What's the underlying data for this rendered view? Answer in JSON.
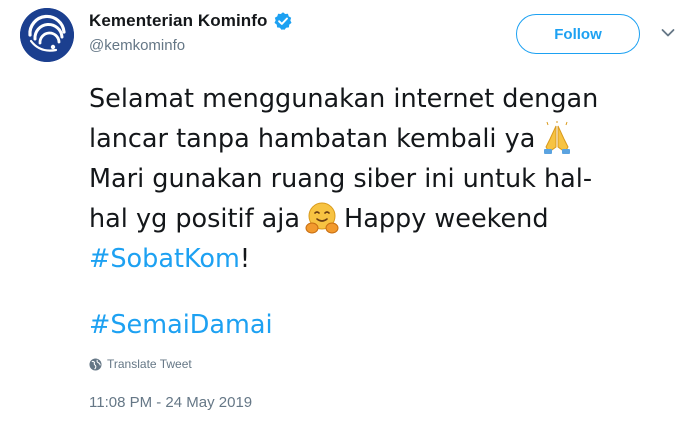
{
  "author": {
    "display_name": "Kementerian Kominfo",
    "handle": "@kemkominfo",
    "verified": true,
    "avatar_icon": "kominfo-logo-icon"
  },
  "actions": {
    "follow_label": "Follow",
    "menu_icon": "chevron-down-icon"
  },
  "tweet": {
    "line1": "Selamat menggunakan internet dengan",
    "line2": "lancar tanpa hambatan kembali ya",
    "line2_emoji": "folded-hands-emoji",
    "line3": "Mari gunakan ruang siber ini untuk hal-",
    "line4_a": "hal yg positif aja",
    "line4_emoji": "hugging-face-emoji",
    "line4_b": "Happy weekend",
    "hashtag1": "#SobatKom",
    "hashtag1_suffix": "!",
    "hashtag2": "#SemaiDamai"
  },
  "translate_label": "Translate Tweet",
  "timestamp": "11:08 PM - 24 May 2019",
  "colors": {
    "link": "#1da1f2",
    "secondary_text": "#657786",
    "primary_text": "#14171a",
    "avatar_bg": "#1b3f8f"
  }
}
